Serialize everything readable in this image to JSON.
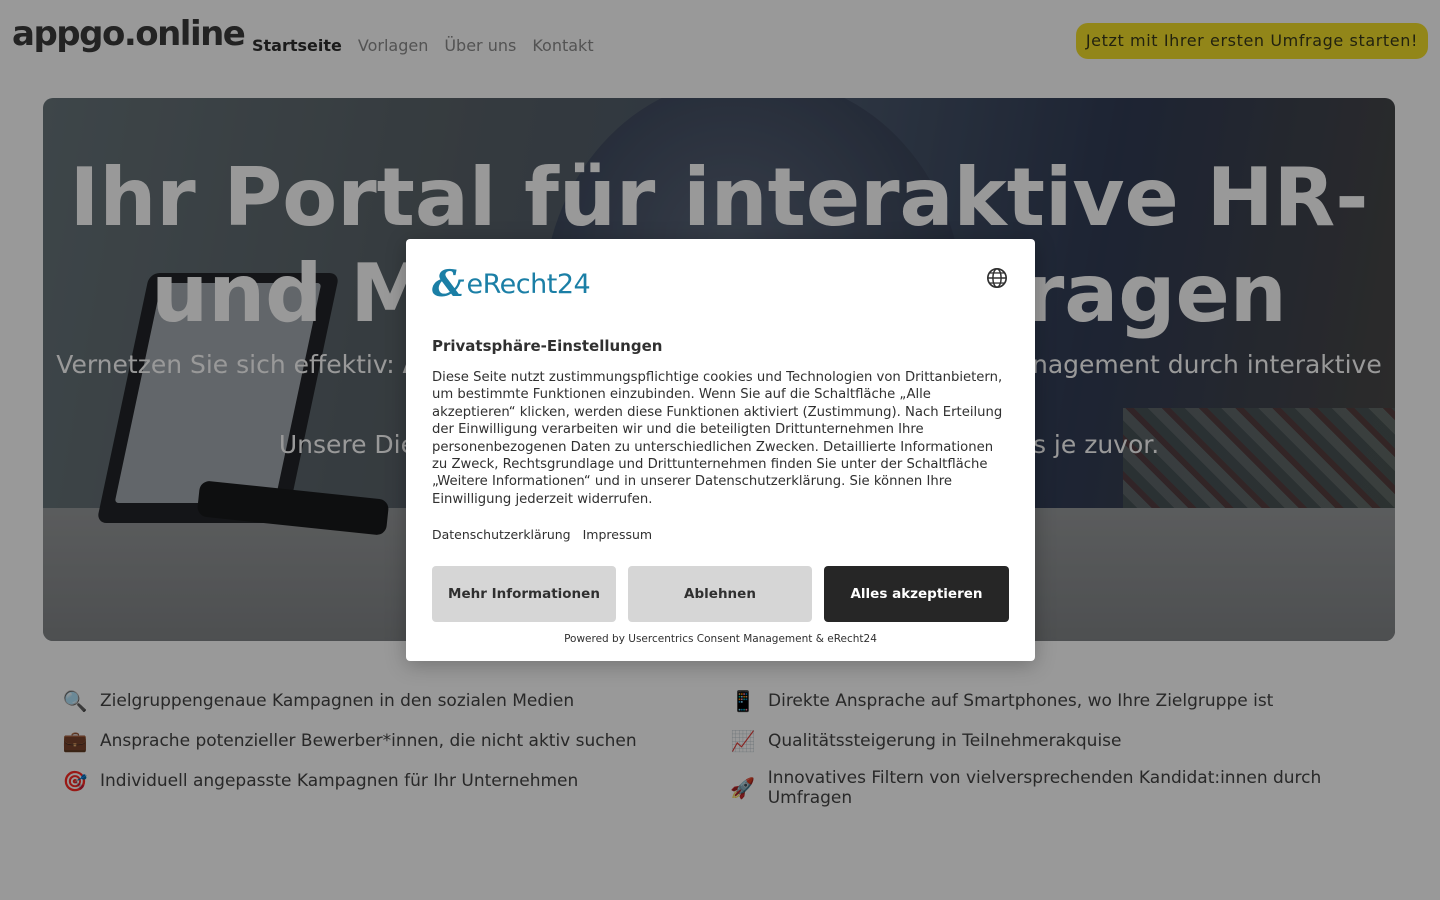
{
  "header": {
    "logo": "appgo.online",
    "nav": [
      "Startseite",
      "Vorlagen",
      "Über uns",
      "Kontakt"
    ],
    "active_nav": "Startseite",
    "cta": "Jetzt mit Ihrer ersten Umfrage starten!"
  },
  "hero": {
    "title": "Ihr Portal für interaktive HR- und Marketing-Umfragen",
    "subtitle_prefix": "Vernetzen Sie sich effektiv: ",
    "subtitle_bold": "A",
    "subtitle_tail": "nagement durch interaktive",
    "subtitle2_prefix": "Unsere Die",
    "subtitle2_tail": "ls je zuvor."
  },
  "features": [
    {
      "icon": "magnifier-icon",
      "glyph": "🔍",
      "text": "Zielgruppengenaue Kampagnen in den sozialen Medien"
    },
    {
      "icon": "smartphone-icon",
      "glyph": "📱",
      "text": "Direkte Ansprache auf Smartphones, wo Ihre Zielgruppe ist"
    },
    {
      "icon": "briefcase-icon",
      "glyph": "💼",
      "text": "Ansprache potenzieller Bewerber*innen, die nicht aktiv suchen"
    },
    {
      "icon": "chart-increasing-icon",
      "glyph": "📈",
      "text": "Qualitätssteigerung in Teilnehmerakquise"
    },
    {
      "icon": "target-icon",
      "glyph": "🎯",
      "text": "Individuell angepasste Kampagnen für Ihr Unternehmen"
    },
    {
      "icon": "rocket-icon",
      "glyph": "🚀",
      "text": "Innovatives Filtern von vielversprechenden Kandidat:innen durch Umfragen"
    }
  ],
  "consent": {
    "brand": "eRecht24",
    "title": "Privatsphäre-Einstellungen",
    "description": "Diese Seite nutzt zustimmungspflichtige cookies und Technologien von Drittanbietern, um bestimmte Funktionen einzubinden. Wenn Sie auf die Schaltfläche „Alle akzeptieren“ klicken, werden diese Funktionen aktiviert (Zustimmung). Nach Erteilung der Einwilligung verarbeiten wir und die beteiligten Drittunternehmen Ihre personenbezogenen Daten zu unterschiedlichen Zwecken. Detaillierte Informationen zu Zweck, Rechtsgrundlage und Drittunternehmen finden Sie unter der Schaltfläche „Weitere Informationen“ und in unserer Datenschutzerklärung. Sie können Ihre Einwilligung jederzeit widerrufen.",
    "link_privacy": "Datenschutzerklärung",
    "link_imprint": "Impressum",
    "btn_more": "Mehr Informationen",
    "btn_decline": "Ablehnen",
    "btn_accept": "Alles akzeptieren",
    "powered_by": "Powered by Usercentrics Consent Management & eRecht24"
  },
  "colors": {
    "cta": "#f3df2a",
    "brand": "#1b7fa6",
    "accept_button": "#262626",
    "secondary_button": "#d6d6d6"
  }
}
